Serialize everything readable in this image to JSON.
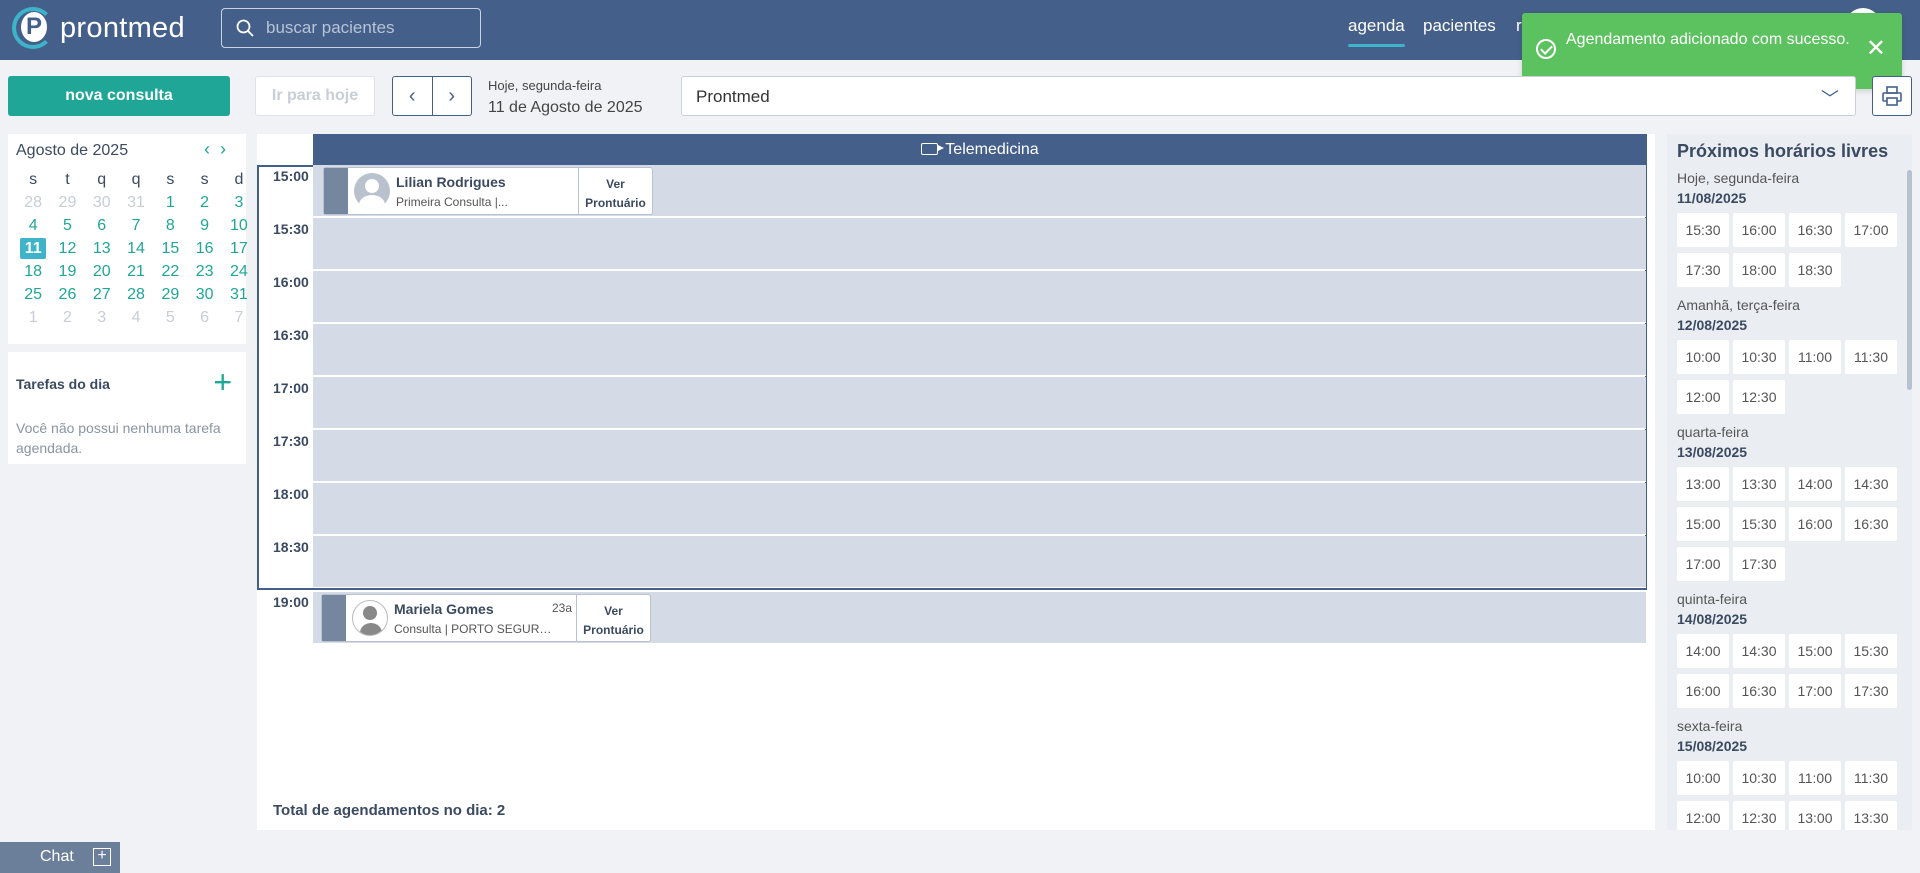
{
  "header": {
    "logo_text": "prontmed",
    "search_placeholder": "buscar pacientes",
    "nav": [
      {
        "label": "agenda",
        "active": true
      },
      {
        "label": "pacientes",
        "active": false
      },
      {
        "label": "r",
        "active": false
      }
    ]
  },
  "toast": {
    "message": "Agendamento adicionado com sucesso.",
    "color": "#5cc15f"
  },
  "toolbar": {
    "new_label": "nova consulta",
    "today_label": "Ir para hoje",
    "date_caption": "Hoje, segunda-feira",
    "date_full": "11 de Agosto de 2025",
    "clinic": "Prontmed"
  },
  "mini_calendar": {
    "month": "Agosto de 2025",
    "weekdays": [
      "s",
      "t",
      "q",
      "q",
      "s",
      "s",
      "d"
    ],
    "days": [
      [
        "28",
        "out"
      ],
      [
        "29",
        "out"
      ],
      [
        "30",
        "out"
      ],
      [
        "31",
        "out"
      ],
      [
        "1",
        "in"
      ],
      [
        "2",
        "in"
      ],
      [
        "3",
        "in"
      ],
      [
        "4",
        "in"
      ],
      [
        "5",
        "in"
      ],
      [
        "6",
        "in"
      ],
      [
        "7",
        "in"
      ],
      [
        "8",
        "in"
      ],
      [
        "9",
        "in"
      ],
      [
        "10",
        "in"
      ],
      [
        "11",
        "sel"
      ],
      [
        "12",
        "in"
      ],
      [
        "13",
        "in"
      ],
      [
        "14",
        "in"
      ],
      [
        "15",
        "in"
      ],
      [
        "16",
        "in"
      ],
      [
        "17",
        "in"
      ],
      [
        "18",
        "in"
      ],
      [
        "19",
        "in"
      ],
      [
        "20",
        "in"
      ],
      [
        "21",
        "in"
      ],
      [
        "22",
        "in"
      ],
      [
        "23",
        "in"
      ],
      [
        "24",
        "in"
      ],
      [
        "25",
        "in"
      ],
      [
        "26",
        "in"
      ],
      [
        "27",
        "in"
      ],
      [
        "28",
        "in"
      ],
      [
        "29",
        "in"
      ],
      [
        "30",
        "in"
      ],
      [
        "31",
        "in"
      ],
      [
        "1",
        "out"
      ],
      [
        "2",
        "out"
      ],
      [
        "3",
        "out"
      ],
      [
        "4",
        "out"
      ],
      [
        "5",
        "out"
      ],
      [
        "6",
        "out"
      ],
      [
        "7",
        "out"
      ]
    ]
  },
  "tasks": {
    "title": "Tarefas do dia",
    "empty": "Você não possui nenhuma tarefa agendada."
  },
  "schedule": {
    "column": "Telemedicina",
    "times": [
      "15:00",
      "15:30",
      "16:00",
      "16:30",
      "17:00",
      "17:30",
      "18:00",
      "18:30",
      "19:00"
    ],
    "appointments": [
      {
        "name": "Lilian Rodrigues",
        "age": "",
        "detail": "Primeira Consulta |...",
        "action_line1": "Ver",
        "action_line2": "Prontuário"
      },
      {
        "name": "Mariela Gomes",
        "age": "23a",
        "detail": "Consulta | PORTO SEGURO...",
        "action_line1": "Ver",
        "action_line2": "Prontuário"
      }
    ],
    "total": "Total de agendamentos no dia: 2"
  },
  "free_slots": {
    "title": "Próximos horários livres",
    "days": [
      {
        "label": "Hoje, segunda-feira",
        "date": "11/08/2025",
        "times": [
          "15:30",
          "16:00",
          "16:30",
          "17:00",
          "17:30",
          "18:00",
          "18:30"
        ]
      },
      {
        "label": "Amanhã, terça-feira",
        "date": "12/08/2025",
        "times": [
          "10:00",
          "10:30",
          "11:00",
          "11:30",
          "12:00",
          "12:30"
        ]
      },
      {
        "label": "quarta-feira",
        "date": "13/08/2025",
        "times": [
          "13:00",
          "13:30",
          "14:00",
          "14:30",
          "15:00",
          "15:30",
          "16:00",
          "16:30",
          "17:00",
          "17:30"
        ]
      },
      {
        "label": "quinta-feira",
        "date": "14/08/2025",
        "times": [
          "14:00",
          "14:30",
          "15:00",
          "15:30",
          "16:00",
          "16:30",
          "17:00",
          "17:30"
        ]
      },
      {
        "label": "sexta-feira",
        "date": "15/08/2025",
        "times": [
          "10:00",
          "10:30",
          "11:00",
          "11:30",
          "12:00",
          "12:30",
          "13:00",
          "13:30"
        ]
      }
    ]
  },
  "chat": {
    "label": "Chat"
  }
}
